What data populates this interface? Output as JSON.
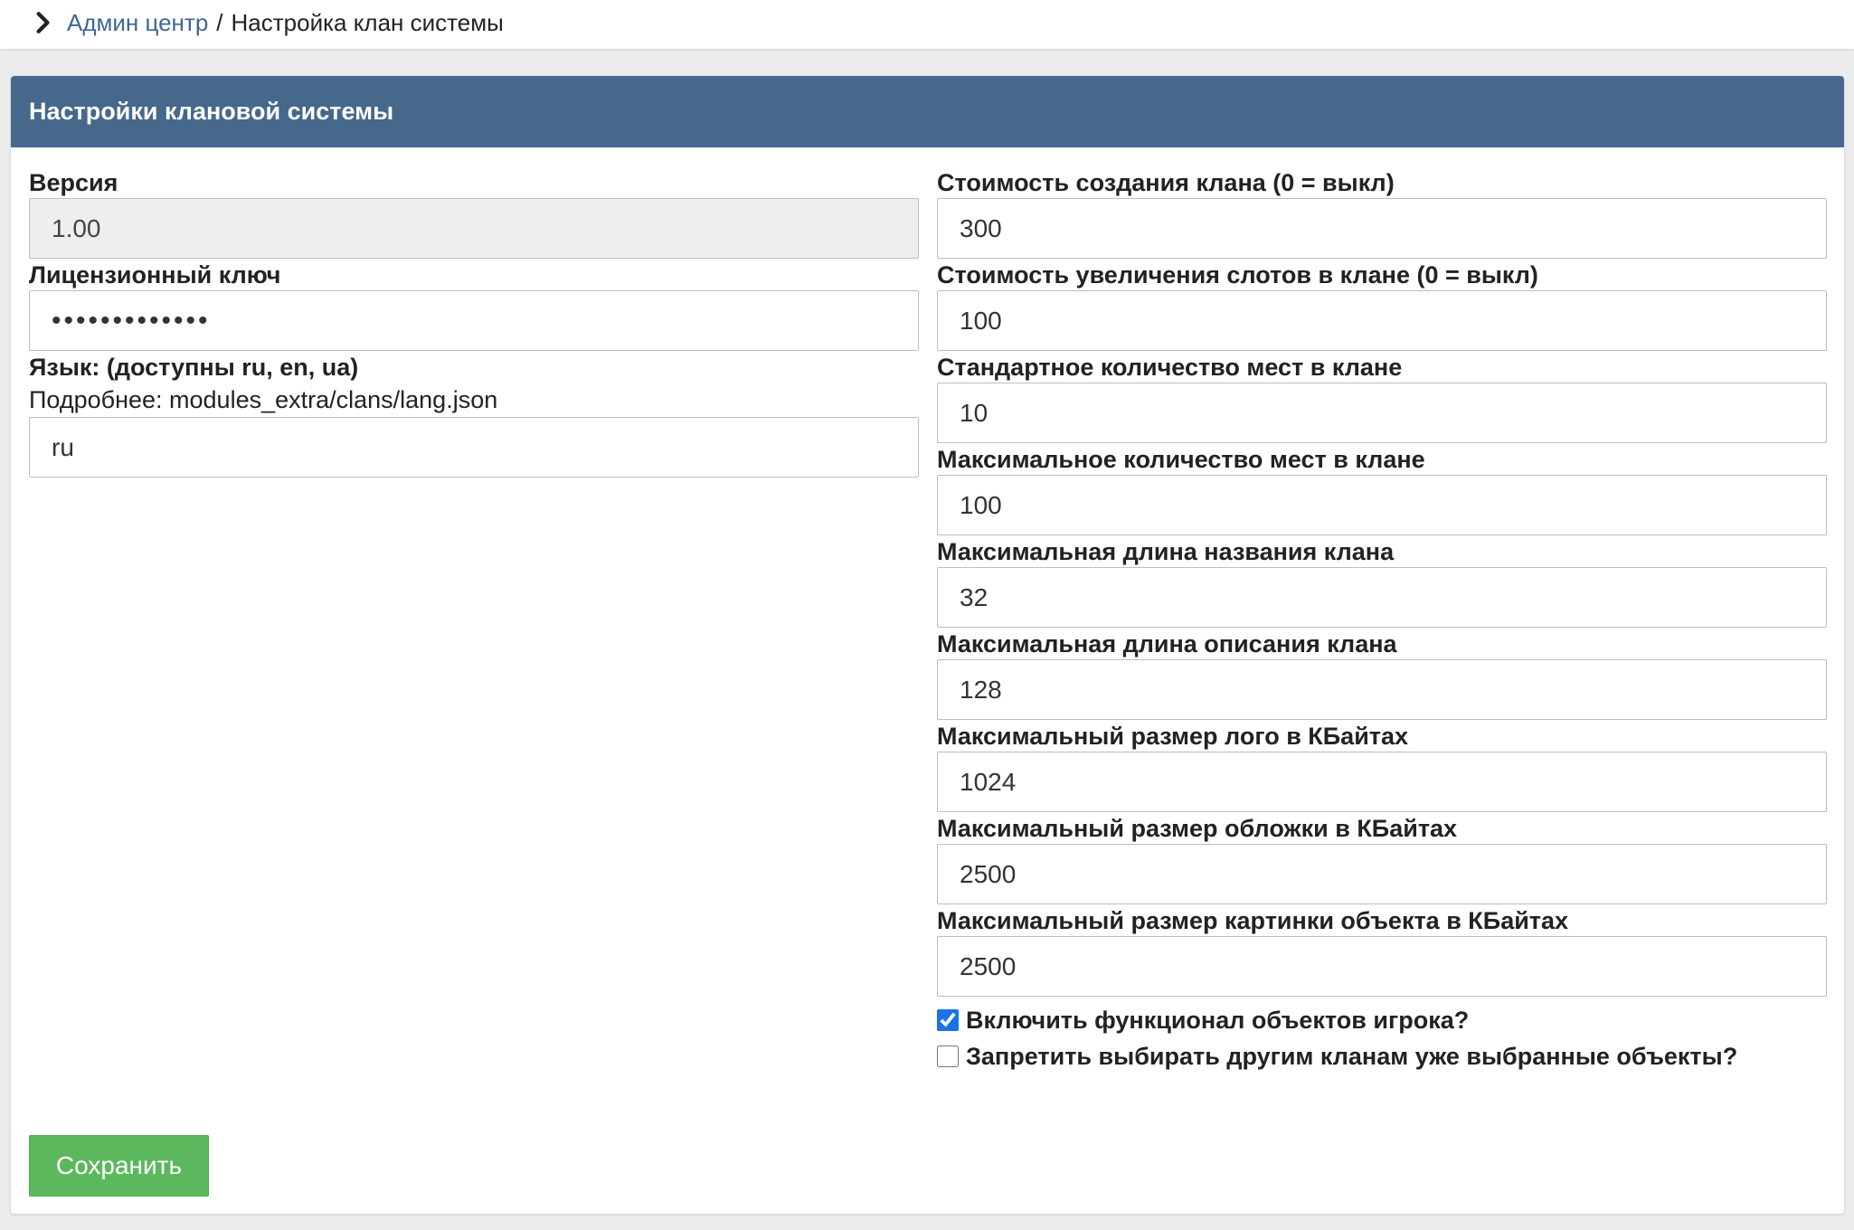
{
  "breadcrumb": {
    "link": "Админ центр",
    "separator": "/",
    "current": "Настройка клан системы"
  },
  "panel": {
    "title": "Настройки клановой системы"
  },
  "left": {
    "version": {
      "label": "Версия",
      "value": "1.00"
    },
    "license": {
      "label": "Лицензионный ключ",
      "value": "•••••••••••••"
    },
    "language": {
      "label": "Язык: (доступны ru, en, ua)",
      "hint": "Подробнее: modules_extra/clans/lang.json",
      "value": "ru"
    }
  },
  "right": {
    "fields": [
      {
        "label": "Стоимость создания клана (0 = выкл)",
        "value": "300"
      },
      {
        "label": "Стоимость увеличения слотов в клане (0 = выкл)",
        "value": "100"
      },
      {
        "label": "Стандартное количество мест в клане",
        "value": "10"
      },
      {
        "label": "Максимальное количество мест в клане",
        "value": "100"
      },
      {
        "label": "Максимальная длина названия клана",
        "value": "32"
      },
      {
        "label": "Максимальная длина описания клана",
        "value": "128"
      },
      {
        "label": "Максимальный размер лого в КБайтах",
        "value": "1024"
      },
      {
        "label": "Максимальный размер обложки в КБайтах",
        "value": "2500"
      },
      {
        "label": "Максимальный размер картинки объекта в КБайтах",
        "value": "2500"
      }
    ],
    "checkboxes": [
      {
        "label": "Включить функционал объектов игрока?",
        "checked": true
      },
      {
        "label": "Запретить выбирать другим кланам уже выбранные объекты?",
        "checked": false
      }
    ]
  },
  "save_button": "Сохранить",
  "colors": {
    "header": "#45688b",
    "link": "#3f6793",
    "save": "#5cb85c",
    "checkbox": "#1a73e8"
  },
  "icons": {
    "breadcrumb": "chevron-right-icon"
  }
}
